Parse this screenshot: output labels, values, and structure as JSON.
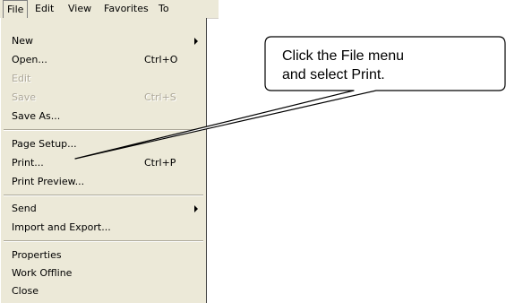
{
  "menubar": {
    "items": [
      "File",
      "Edit",
      "View",
      "Favorites",
      "To"
    ]
  },
  "file_menu": {
    "new": "New",
    "open": "Open...",
    "open_shortcut": "Ctrl+O",
    "edit": "Edit",
    "save": "Save",
    "save_shortcut": "Ctrl+S",
    "save_as": "Save As...",
    "page_setup": "Page Setup...",
    "print": "Print...",
    "print_shortcut": "Ctrl+P",
    "print_preview": "Print Preview...",
    "send": "Send",
    "import_export": "Import and Export...",
    "properties": "Properties",
    "work_offline": "Work Offline",
    "close": "Close"
  },
  "callout": {
    "line1": "Click the File menu",
    "line2": "and select Print."
  }
}
